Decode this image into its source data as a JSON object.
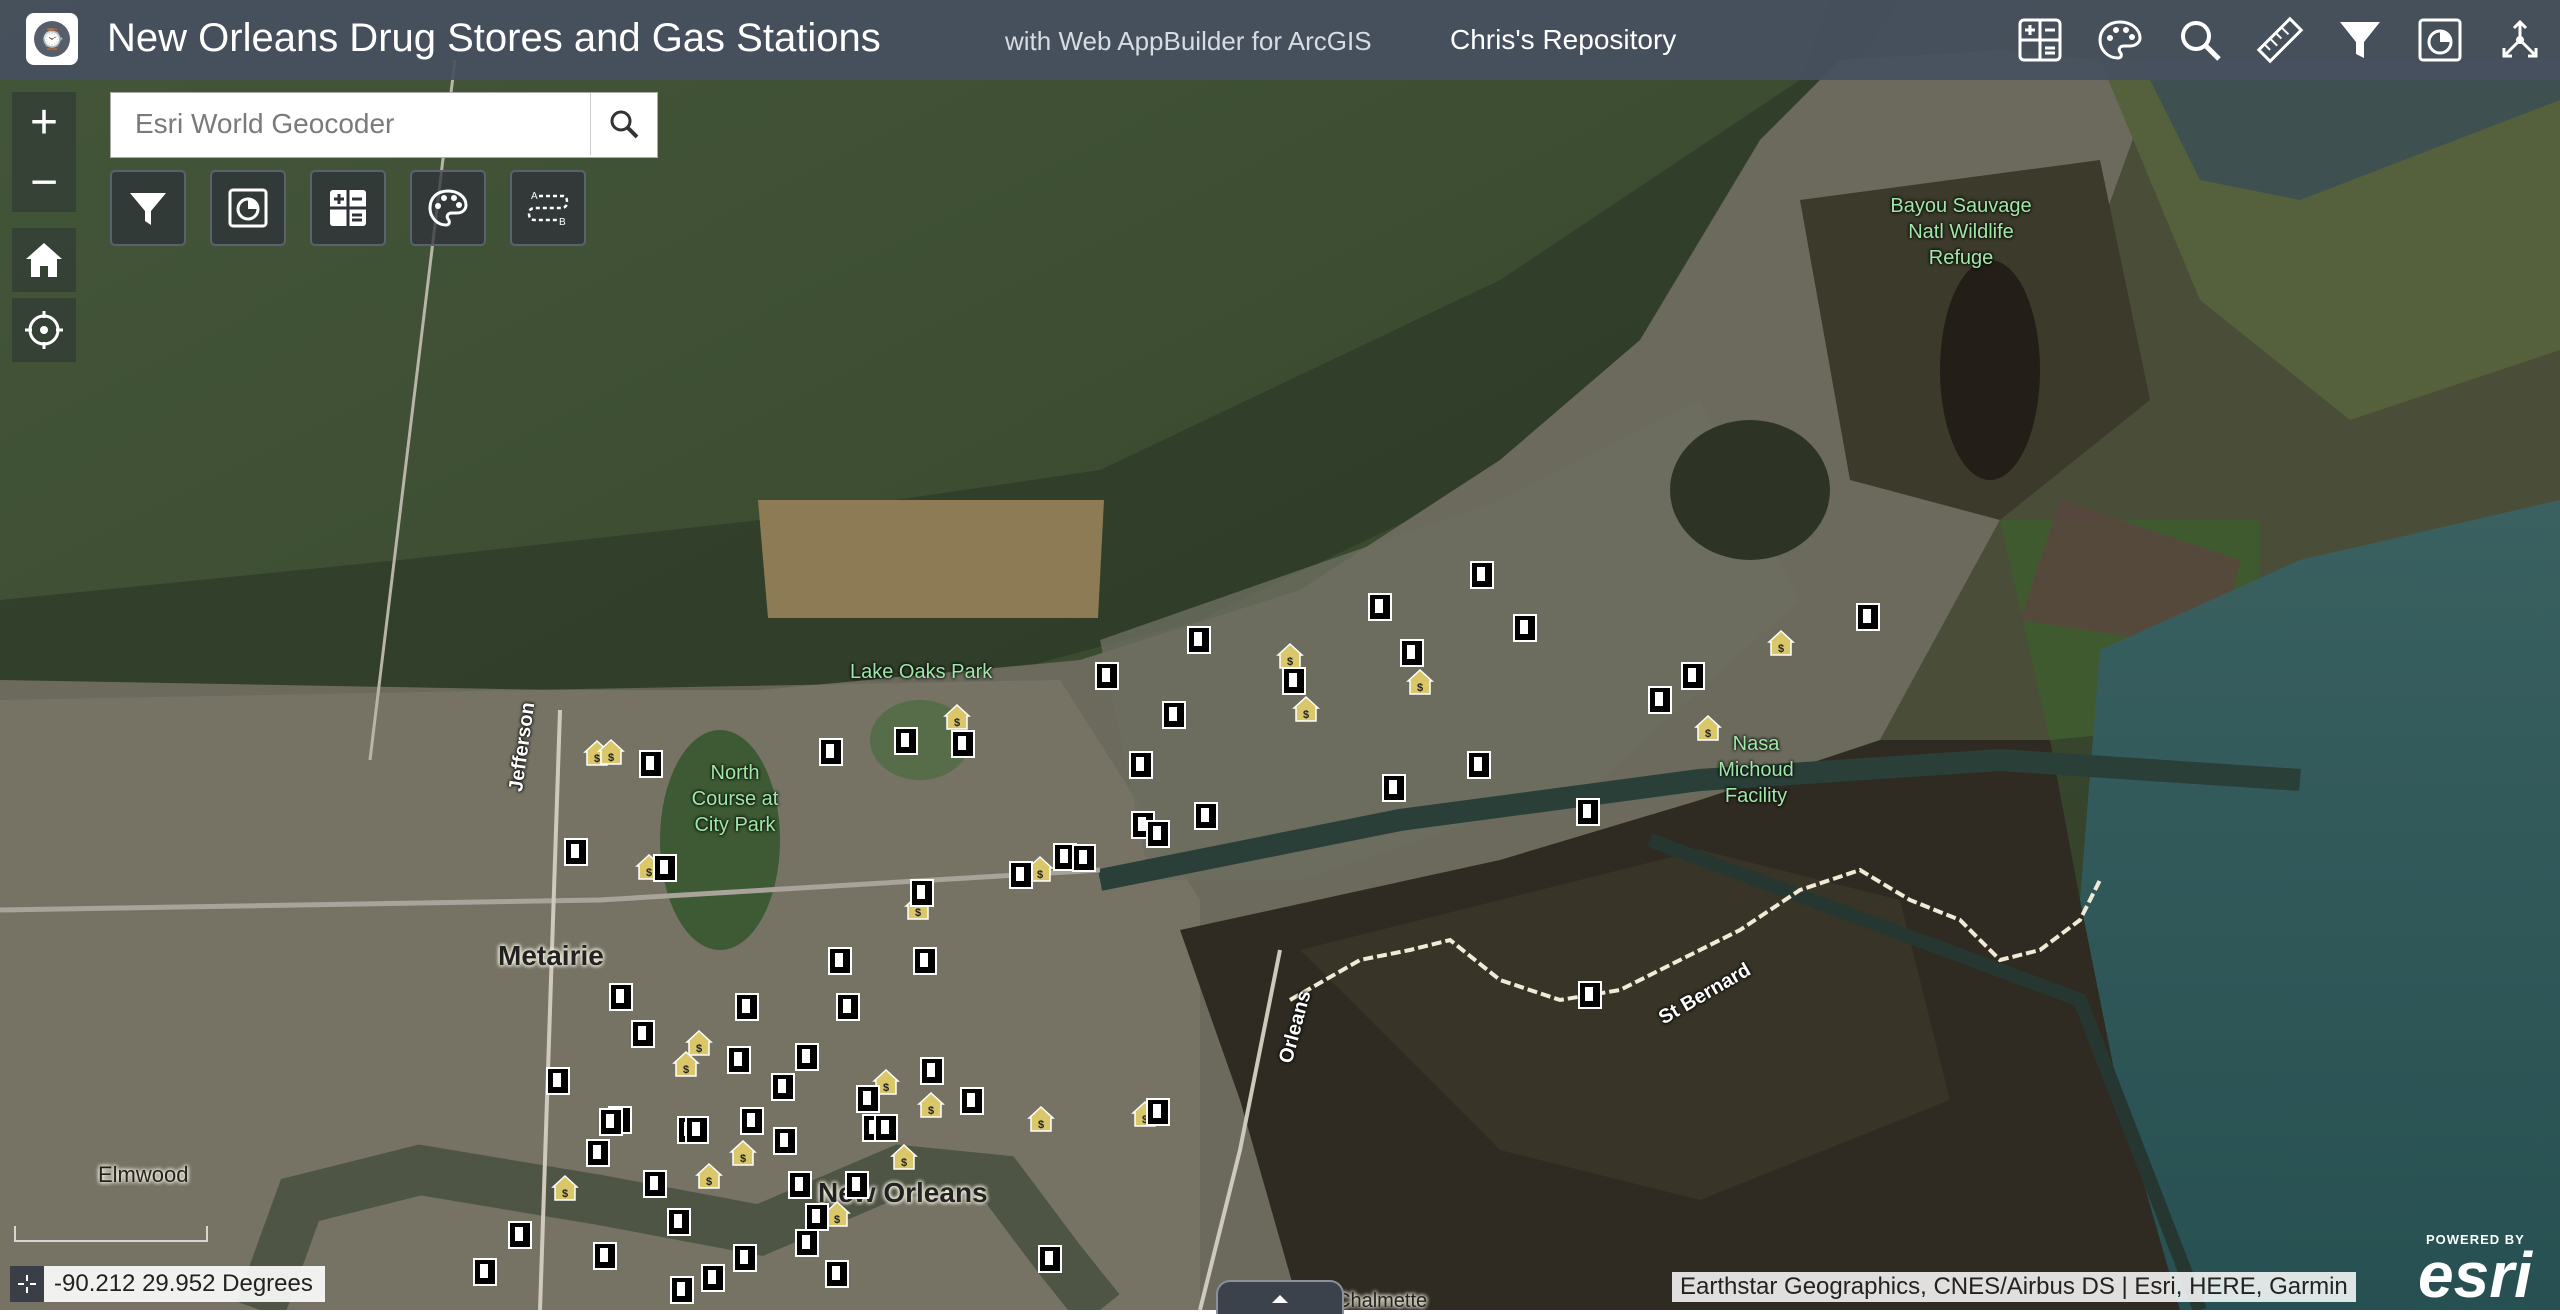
{
  "header": {
    "title": "New Orleans Drug Stores and Gas Stations",
    "subtitle": "with Web AppBuilder for ArcGIS",
    "repository": "Chris's Repository",
    "widget_icons": [
      "calculator-icon",
      "palette-icon",
      "search-icon",
      "measure-icon",
      "filter-icon",
      "chart-icon",
      "share-icon"
    ]
  },
  "map_controls": {
    "zoom_in": "+",
    "zoom_out": "−",
    "home_icon": "home-icon",
    "locate_icon": "locate-icon"
  },
  "search": {
    "placeholder": "Esri World Geocoder"
  },
  "toolbar": {
    "buttons": [
      "filter-icon",
      "chart-icon",
      "calculator-icon",
      "palette-icon",
      "directions-icon"
    ]
  },
  "map_labels": {
    "places": [
      "Bayou Sauvage Natl Wildlife Refuge",
      "Lake Oaks Park",
      "North Course at City Park",
      "Nasa Michoud Facility"
    ],
    "cities": [
      "Metairie",
      "New Orleans",
      "Elmwood",
      "Chalmette"
    ],
    "roads": [
      "Jefferson",
      "Orleans",
      "St Bernard"
    ]
  },
  "status": {
    "coordinates": "-90.212 29.952 Degrees",
    "attribution": "Earthstar Geographics, CNES/Airbus DS | Esri, HERE, Garmin",
    "powered_by": "POWERED BY",
    "esri": "esri"
  },
  "colors": {
    "header_bg": "#46505f",
    "gas_marker": "#000000",
    "drug_marker": "#d9c76a",
    "lake": "#3c4a2c"
  }
}
